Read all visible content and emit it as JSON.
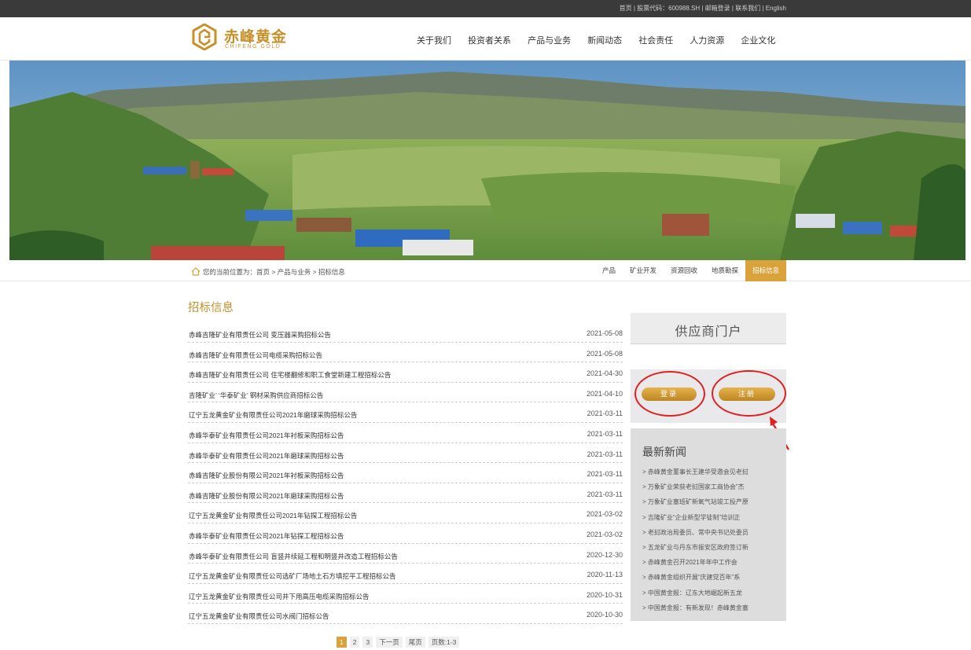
{
  "topbar": {
    "home": "首页",
    "stock": "股票代码：600988.SH",
    "mail": "邮箱登录",
    "contact": "联系我们",
    "lang": "English",
    "sep": " | "
  },
  "logo": {
    "cn": "赤峰黄金",
    "en": "CHIFENG GOLD"
  },
  "nav": [
    "关于我们",
    "投资者关系",
    "产品与业务",
    "新闻动态",
    "社会责任",
    "人力资源",
    "企业文化"
  ],
  "breadcrumb": {
    "prefix": "您的当前位置为：",
    "path": "首页 > 产品与业务 > 招标信息"
  },
  "subnav": [
    "产品",
    "矿业开发",
    "资源回收",
    "地质勘探",
    "招标信息"
  ],
  "section_title": "招标信息",
  "tenders": [
    {
      "title": "赤峰吉隆矿业有限责任公司 变压器采购招标公告",
      "date": "2021-05-08"
    },
    {
      "title": "赤峰吉隆矿业有限责任公司电缆采购招标公告",
      "date": "2021-05-08"
    },
    {
      "title": "赤峰吉隆矿业有限责任公司 住宅楼翻修和职工食堂新建工程招标公告",
      "date": "2021-04-30"
    },
    {
      "title": "吉隆矿业’ ‘华泰矿业’ 钢材采购供应商招标公告",
      "date": "2021-04-10"
    },
    {
      "title": "辽宁五龙黄金矿业有限责任公司2021年磨球采购招标公告",
      "date": "2021-03-11"
    },
    {
      "title": "赤峰华泰矿业有限责任公司2021年衬板采购招标公告",
      "date": "2021-03-11"
    },
    {
      "title": "赤峰华泰矿业有限责任公司2021年磨球采购招标公告",
      "date": "2021-03-11"
    },
    {
      "title": "赤峰吉隆矿业股份有限公司2021年衬板采购招标公告",
      "date": "2021-03-11"
    },
    {
      "title": "赤峰吉隆矿业股份有限公司2021年磨球采购招标公告",
      "date": "2021-03-11"
    },
    {
      "title": "辽宁五龙黄金矿业有限责任公司2021年钻探工程招标公告",
      "date": "2021-03-02"
    },
    {
      "title": "赤峰华泰矿业有限责任公司2021年钻探工程招标公告",
      "date": "2021-03-02"
    },
    {
      "title": "赤峰华泰矿业有限责任公司 盲竖井续延工程和明竖井改造工程招标公告",
      "date": "2020-12-30"
    },
    {
      "title": "辽宁五龙黄金矿业有限责任公司选矿厂场地土石方填挖平工程招标公告",
      "date": "2020-11-13"
    },
    {
      "title": "辽宁五龙黄金矿业有限责任公司井下用高压电缆采购招标公告",
      "date": "2020-10-31"
    },
    {
      "title": "辽宁五龙黄金矿业有限责任公司水阀门招标公告",
      "date": "2020-10-30"
    }
  ],
  "pager": {
    "pages": [
      "1",
      "2",
      "3"
    ],
    "next": "下一页",
    "last": "尾页",
    "count": "页数:1-3"
  },
  "portal": {
    "title": "供应商门户",
    "login": "登录",
    "register": "注册"
  },
  "news": {
    "title": "最新新闻",
    "items": [
      "> 赤峰黄金董事长王建华受邀会见老挝",
      "> 万象矿业荣获老挝国家工商协会”杰",
      "> 万象矿业塞班矿新氧气站竣工投产原",
      "> 吉隆矿业“企业新型学徒制”培训正",
      "> 老挝政治局委员、常中央书记处委员",
      "> 五龙矿业与丹东市振安区政府签订新",
      "> 赤峰黄金召开2021年年中工作会",
      "> 赤峰黄金组织开展“庆建党百年”系",
      "> 中国黄金报：辽东大地崛起新五龙",
      "> 中国黄金报：有新发现！赤峰黄金塞"
    ]
  },
  "colors": {
    "gold": "#c8902a",
    "active": "#d9a23b",
    "annotation": "#e02020"
  }
}
